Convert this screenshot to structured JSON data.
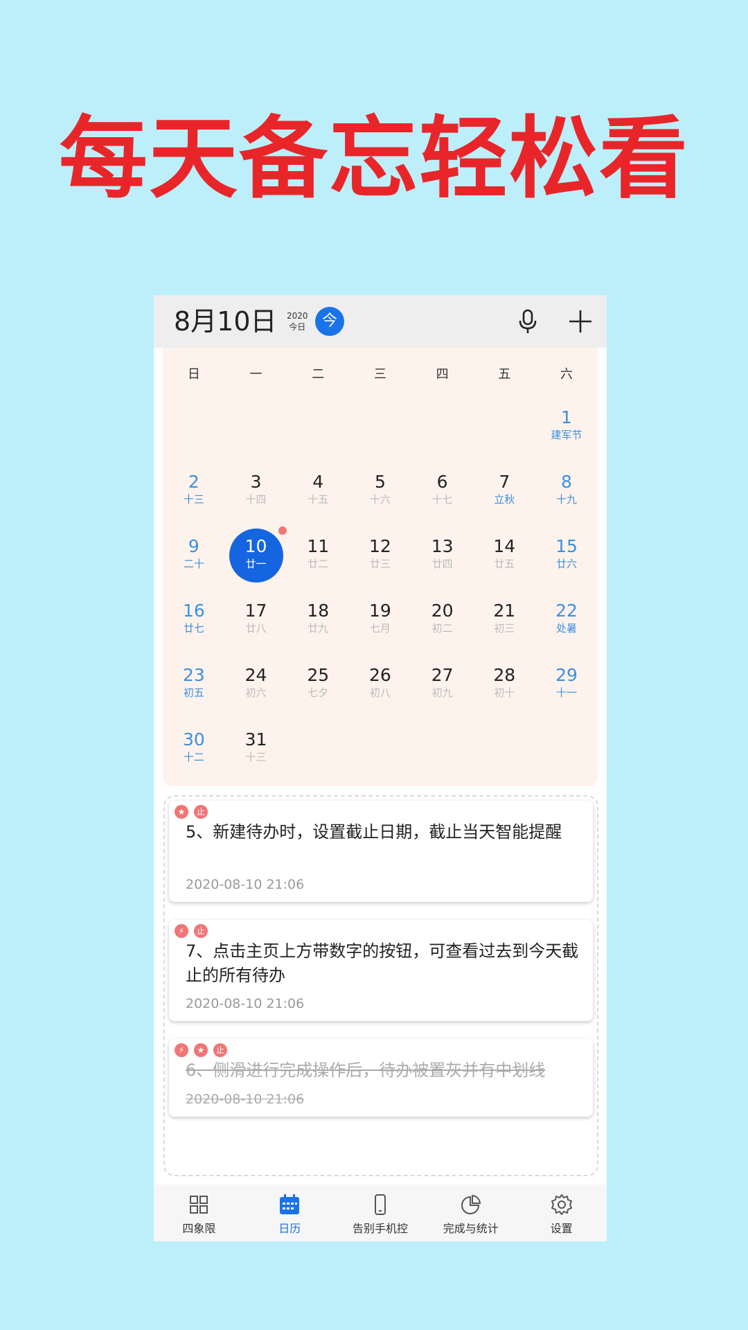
{
  "headline": "每天备忘轻松看",
  "header": {
    "date": "8月10日",
    "year": "2020",
    "today_sub": "今日",
    "today_button": "今"
  },
  "calendar": {
    "weekdays": [
      "日",
      "一",
      "二",
      "三",
      "四",
      "五",
      "六"
    ],
    "weeks": [
      [
        null,
        null,
        null,
        null,
        null,
        null,
        {
          "day": "1",
          "lunar": "建军节"
        }
      ],
      [
        {
          "day": "2",
          "lunar": "十三"
        },
        {
          "day": "3",
          "lunar": "十四"
        },
        {
          "day": "4",
          "lunar": "十五"
        },
        {
          "day": "5",
          "lunar": "十六"
        },
        {
          "day": "6",
          "lunar": "十七"
        },
        {
          "day": "7",
          "lunar": "立秋"
        },
        {
          "day": "8",
          "lunar": "十九"
        }
      ],
      [
        {
          "day": "9",
          "lunar": "二十"
        },
        {
          "day": "10",
          "lunar": "廿一"
        },
        {
          "day": "11",
          "lunar": "廿二"
        },
        {
          "day": "12",
          "lunar": "廿三"
        },
        {
          "day": "13",
          "lunar": "廿四"
        },
        {
          "day": "14",
          "lunar": "廿五"
        },
        {
          "day": "15",
          "lunar": "廿六"
        }
      ],
      [
        {
          "day": "16",
          "lunar": "廿七"
        },
        {
          "day": "17",
          "lunar": "廿八"
        },
        {
          "day": "18",
          "lunar": "廿九"
        },
        {
          "day": "19",
          "lunar": "七月"
        },
        {
          "day": "20",
          "lunar": "初二"
        },
        {
          "day": "21",
          "lunar": "初三"
        },
        {
          "day": "22",
          "lunar": "处暑"
        }
      ],
      [
        {
          "day": "23",
          "lunar": "初五"
        },
        {
          "day": "24",
          "lunar": "初六"
        },
        {
          "day": "25",
          "lunar": "七夕"
        },
        {
          "day": "26",
          "lunar": "初八"
        },
        {
          "day": "27",
          "lunar": "初九"
        },
        {
          "day": "28",
          "lunar": "初十"
        },
        {
          "day": "29",
          "lunar": "十一"
        }
      ],
      [
        {
          "day": "30",
          "lunar": "十二"
        },
        {
          "day": "31",
          "lunar": "十三"
        },
        null,
        null,
        null,
        null,
        null
      ]
    ],
    "selected_day": "10",
    "festival_days": [
      "1",
      "7"
    ],
    "event_dot_day": "10"
  },
  "tasks": [
    {
      "tags": [
        "★",
        "止"
      ],
      "text": "5、新建待办时，设置截止日期，截止当天智能提醒",
      "time": "2020-08-10 21:06",
      "done": false
    },
    {
      "tags": [
        "⚡",
        "止"
      ],
      "text": "7、点击主页上方带数字的按钮，可查看过去到今天截止的所有待办",
      "time": "2020-08-10 21:06",
      "done": false
    },
    {
      "tags": [
        "⚡",
        "★",
        "止"
      ],
      "text": "6、侧滑进行完成操作后，待办被置灰并有中划线",
      "time": "2020-08-10 21:06",
      "done": true
    }
  ],
  "nav": [
    {
      "label": "四象限",
      "icon": "grid-icon",
      "active": false
    },
    {
      "label": "日历",
      "icon": "calendar-icon",
      "active": true
    },
    {
      "label": "告别手机控",
      "icon": "phone-icon",
      "active": false
    },
    {
      "label": "完成与统计",
      "icon": "pie-chart-icon",
      "active": false
    },
    {
      "label": "设置",
      "icon": "gear-icon",
      "active": false
    }
  ],
  "colors": {
    "background": "#bdeffa",
    "headline": "#e8262a",
    "accent": "#1a73e8",
    "weekend": "#3d8fe0",
    "tag": "#f07575"
  }
}
